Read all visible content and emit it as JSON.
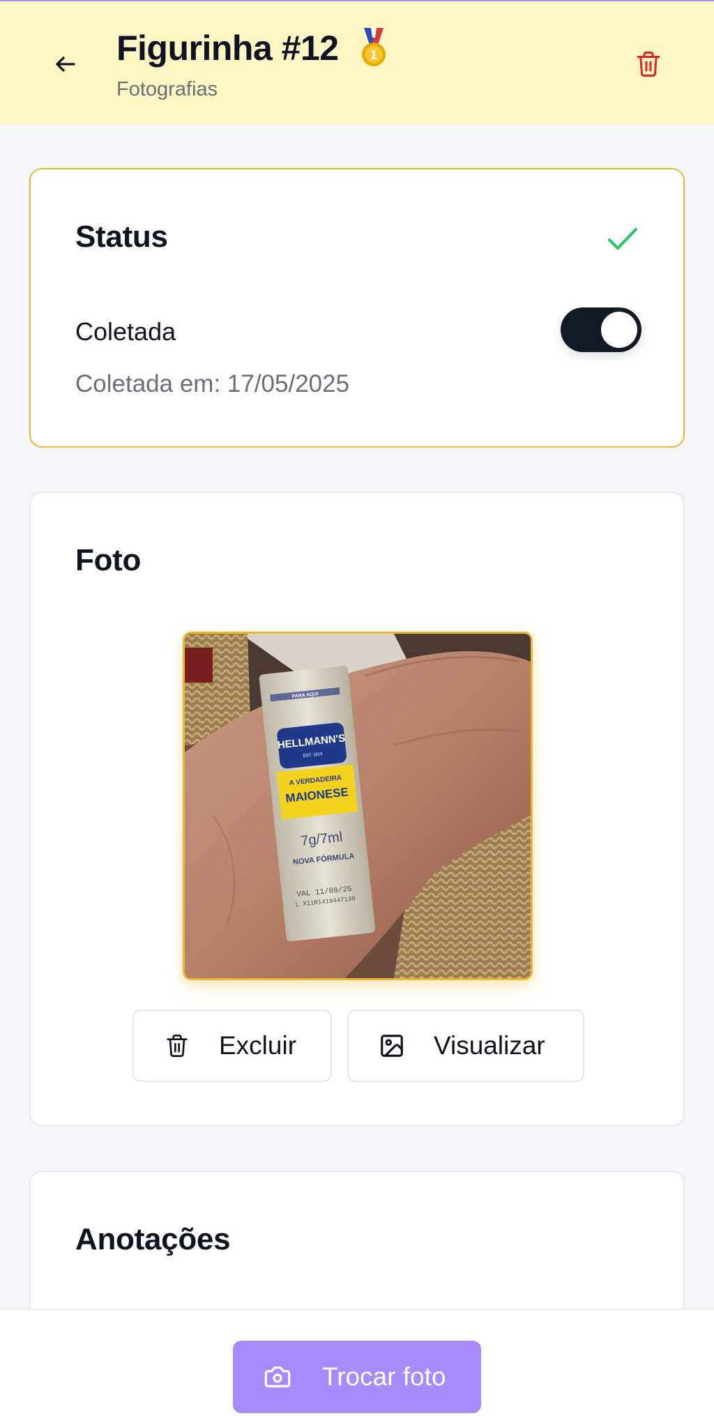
{
  "header": {
    "title": "Figurinha #12",
    "subtitle": "Fotografias",
    "back_icon": "arrow-left-icon",
    "medal_icon": "first-place-medal-icon",
    "medal_glyph": "1",
    "delete_icon": "trash-icon"
  },
  "status_card": {
    "title": "Status",
    "check_icon": "check-icon",
    "collected_label": "Coletada",
    "collected": true,
    "collected_date_text": "Coletada em: 17/05/2025"
  },
  "photo_card": {
    "title": "Foto",
    "photo_printed_text": {
      "tear_strip": "PARA AQUI",
      "brand": "HELLMANN'S",
      "est": "EST. 1913",
      "tagline": "A VERDADEIRA",
      "product": "MAIONESE",
      "weight": "7g/7ml",
      "note": "NOVA FÓRMULA",
      "expiry": "VAL 11/09/25",
      "lot": "L X11R1419447130"
    },
    "delete_button_label": "Excluir",
    "view_button_label": "Visualizar",
    "delete_icon": "trash-icon",
    "view_icon": "image-icon"
  },
  "notes_card": {
    "title": "Anotações"
  },
  "bottom_bar": {
    "change_photo_label": "Trocar foto",
    "camera_icon": "camera-icon"
  },
  "colors": {
    "header_bg": "#fef7c3",
    "accent_purple": "#a78bfa",
    "accent_gold": "#e8b931",
    "danger_red": "#dc2626",
    "success_green": "#22c55e",
    "toggle_dark": "#131826"
  }
}
